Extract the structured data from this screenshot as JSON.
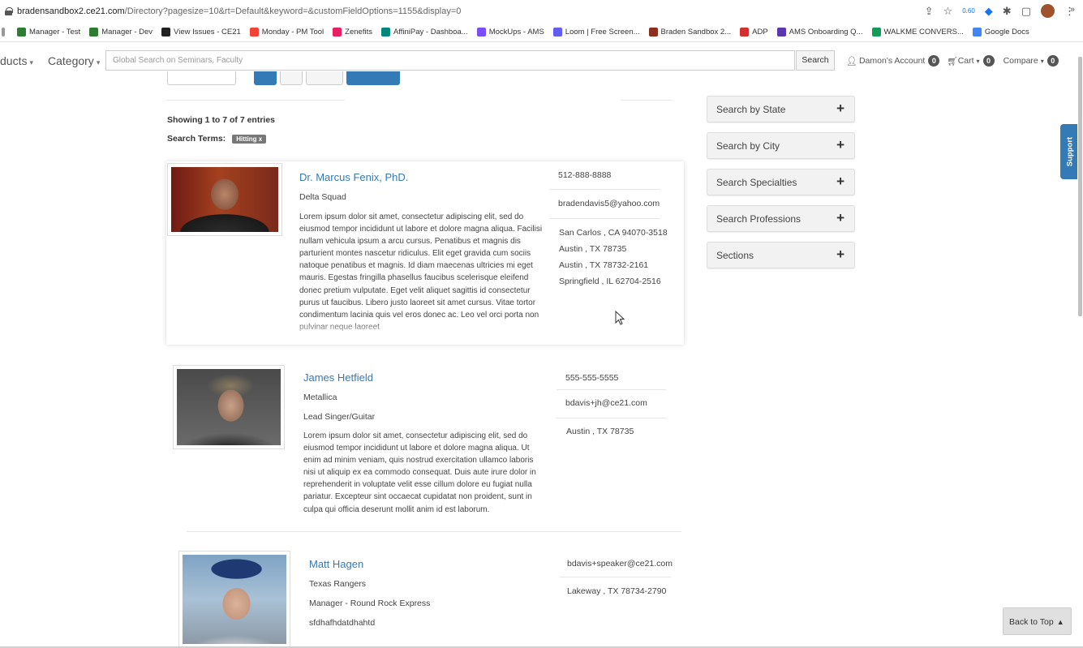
{
  "browser": {
    "url_host": "bradensandbox2.ce21.com",
    "url_path": "/Directory?pagesize=10&rt=Default&keyword=&customFieldOptions=1155&display=0",
    "extension_badge": "0.60"
  },
  "bookmarks": [
    {
      "label": "Manager - Test",
      "color": "#2e7d32"
    },
    {
      "label": "Manager - Dev",
      "color": "#2e7d32"
    },
    {
      "label": "View Issues - CE21",
      "color": "#222222"
    },
    {
      "label": "Monday - PM Tool",
      "color": "#f44336"
    },
    {
      "label": "Zenefits",
      "color": "#e91e63"
    },
    {
      "label": "AffiniPay - Dashboa...",
      "color": "#00897b"
    },
    {
      "label": "MockUps - AMS",
      "color": "#7c4dff"
    },
    {
      "label": "Loom | Free Screen...",
      "color": "#625df5"
    },
    {
      "label": "Braden Sandbox 2...",
      "color": "#8d2f1f"
    },
    {
      "label": "ADP",
      "color": "#d32f2f"
    },
    {
      "label": "AMS Onboarding Q...",
      "color": "#5e35b1"
    },
    {
      "label": "WALKME CONVERS...",
      "color": "#0f9d58"
    },
    {
      "label": "Google Docs",
      "color": "#4285f4"
    }
  ],
  "nav": {
    "products": "ducts",
    "category": "Category",
    "search_placeholder": "Global Search on Seminars, Faculty",
    "search_button": "Search",
    "account": "Damon's Account",
    "account_count": "0",
    "cart": "Cart",
    "cart_count": "0",
    "compare": "Compare",
    "compare_count": "0"
  },
  "results": {
    "showing": "Showing 1 to 7 of 7 entries",
    "search_terms_label": "Search Terms:",
    "search_term": "Hitting x"
  },
  "people": [
    {
      "name": "Dr. Marcus Fenix, PhD.",
      "org": "Delta Squad",
      "desc": "Lorem ipsum dolor sit amet, consectetur adipiscing elit, sed do eiusmod tempor incididunt ut labore et dolore magna aliqua. Facilisi nullam vehicula ipsum a arcu cursus. Penatibus et magnis dis parturient montes nascetur ridiculus. Elit eget gravida cum sociis natoque penatibus et magnis. Id diam maecenas ultricies mi eget mauris. Egestas fringilla phasellus faucibus scelerisque eleifend donec pretium vulputate. Eget velit aliquet sagittis id consectetur purus ut faucibus. Libero justo laoreet sit amet cursus. Vitae tortor condimentum lacinia quis vel eros donec ac. Leo vel orci porta non pulvinar neque laoreet",
      "phone": "512-888-8888",
      "email": "bradendavis5@yahoo.com",
      "addresses": [
        "San Carlos , CA 94070-3518",
        "Austin , TX 78735",
        "Austin , TX 78732-2161",
        "Springfield , IL 62704-2516"
      ]
    },
    {
      "name": "James Hetfield",
      "org": "Metallica",
      "title": "Lead Singer/Guitar",
      "desc": "Lorem ipsum dolor sit amet, consectetur adipiscing elit, sed do eiusmod tempor incididunt ut labore et dolore magna aliqua. Ut enim ad minim veniam, quis nostrud exercitation ullamco laboris nisi ut aliquip ex ea commodo consequat. Duis aute irure dolor in reprehenderit in voluptate velit esse cillum dolore eu fugiat nulla pariatur. Excepteur sint occaecat cupidatat non proident, sunt in culpa qui officia deserunt mollit anim id est laborum.",
      "phone": "555-555-5555",
      "email": "bdavis+jh@ce21.com",
      "addresses": [
        "Austin , TX 78735"
      ]
    },
    {
      "name": "Matt Hagen",
      "org": "Texas Rangers",
      "title": "Manager - Round Rock Express",
      "extra": "sfdhafhdatdhahtd",
      "email": "bdavis+speaker@ce21.com",
      "addresses": [
        "Lakeway , TX 78734-2790"
      ]
    }
  ],
  "filters": [
    "Search by State",
    "Search by City",
    "Search Specialties",
    "Search Professions",
    "Sections"
  ],
  "filter_symbol": "+",
  "support_label": "Support",
  "back_to_top": "Back to Top"
}
